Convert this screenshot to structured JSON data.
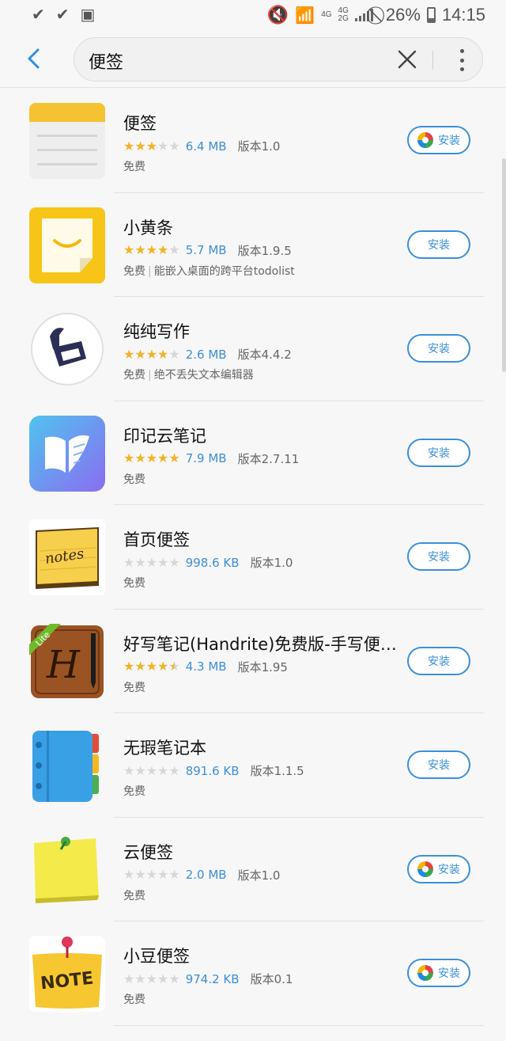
{
  "status_bar": {
    "time": "14:15",
    "battery": "26%",
    "net1": "4G",
    "net2": "4G",
    "net2b": "2G",
    "left_icons": [
      "check-icon",
      "check-icon",
      "image-icon"
    ],
    "right_icons": [
      "mute-icon",
      "wifi-icon",
      "signal-icon",
      "no-disturb-icon",
      "battery-icon"
    ]
  },
  "search": {
    "query": "便签",
    "back_icon": "back-arrow-icon",
    "clear_icon": "close-icon",
    "more_icon": "more-vert-icon"
  },
  "colors": {
    "accent": "#3b8fd8",
    "star": "#f3b32a",
    "star_off": "#d7d7d7"
  },
  "apps": [
    {
      "name": "便签",
      "rating": 3,
      "size": "6.4 MB",
      "version": "版本1.0",
      "price": "免费",
      "desc": "",
      "install": "安装",
      "badge": true
    },
    {
      "name": "小黄条",
      "rating": 4,
      "size": "5.7 MB",
      "version": "版本1.9.5",
      "price": "免费",
      "desc": "能嵌入桌面的跨平台todolist",
      "install": "安装",
      "badge": false
    },
    {
      "name": "纯纯写作",
      "rating": 4,
      "size": "2.6 MB",
      "version": "版本4.4.2",
      "price": "免费",
      "desc": "绝不丢失文本编辑器",
      "install": "安装",
      "badge": false
    },
    {
      "name": "印记云笔记",
      "rating": 5,
      "size": "7.9 MB",
      "version": "版本2.7.11",
      "price": "免费",
      "desc": "",
      "install": "安装",
      "badge": false
    },
    {
      "name": "首页便签",
      "rating": 0,
      "size": "998.6 KB",
      "version": "版本1.0",
      "price": "免费",
      "desc": "",
      "install": "安装",
      "badge": false
    },
    {
      "name": "好写笔记(Handrite)免费版-手写便…",
      "rating": 4.5,
      "size": "4.3 MB",
      "version": "版本1.95",
      "price": "免费",
      "desc": "",
      "install": "安装",
      "badge": false
    },
    {
      "name": "无瑕笔记本",
      "rating": 0,
      "size": "891.6 KB",
      "version": "版本1.1.5",
      "price": "免费",
      "desc": "",
      "install": "安装",
      "badge": false
    },
    {
      "name": "云便签",
      "rating": 0,
      "size": "2.0 MB",
      "version": "版本1.0",
      "price": "免费",
      "desc": "",
      "install": "安装",
      "badge": true
    },
    {
      "name": "小豆便签",
      "rating": 0,
      "size": "974.2 KB",
      "version": "版本0.1",
      "price": "免费",
      "desc": "",
      "install": "安装",
      "badge": true
    }
  ],
  "icon_text": {
    "notes": "notes",
    "handrite_letter": "H",
    "handrite_badge": "Lite",
    "note": "NOTE"
  }
}
